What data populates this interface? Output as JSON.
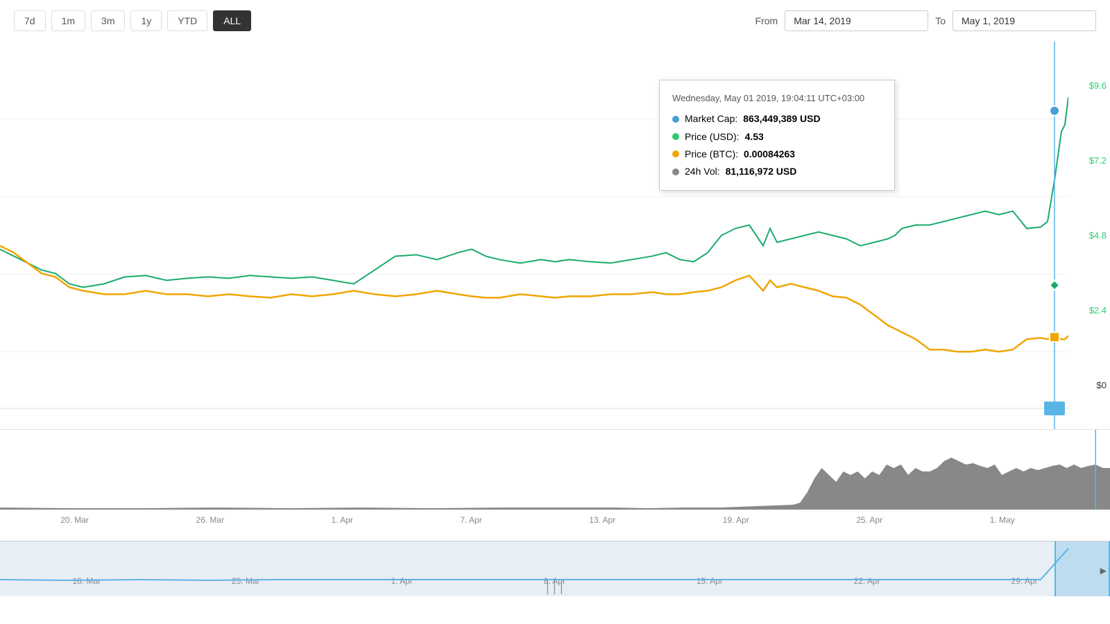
{
  "timeButtons": [
    {
      "label": "7d",
      "active": false
    },
    {
      "label": "1m",
      "active": false
    },
    {
      "label": "3m",
      "active": false
    },
    {
      "label": "1y",
      "active": false
    },
    {
      "label": "YTD",
      "active": false
    },
    {
      "label": "ALL",
      "active": true
    }
  ],
  "dateRange": {
    "fromLabel": "From",
    "fromValue": "Mar 14, 2019",
    "toLabel": "To",
    "toValue": "May 1, 2019"
  },
  "tooltip": {
    "title": "Wednesday, May 01 2019, 19:04:11 UTC+03:00",
    "marketCapLabel": "Market Cap:",
    "marketCapValue": "863,449,389 USD",
    "priceUSDLabel": "Price (USD):",
    "priceUSDValue": "4.53",
    "priceBTCLabel": "Price (BTC):",
    "priceBTCValue": "0.00084263",
    "volLabel": "24h Vol:",
    "volValue": "81,116,972 USD"
  },
  "yAxis": {
    "labels": [
      "$9.6",
      "$7.2",
      "$4.8",
      "$2.4",
      "$0"
    ]
  },
  "xAxis": {
    "labels": [
      "20. Mar",
      "26. Mar",
      "1. Apr",
      "7. Apr",
      "13. Apr",
      "19. Apr",
      "25. Apr",
      "1. May"
    ]
  },
  "navigator": {
    "labels": [
      "18. Mar",
      "25. Mar",
      "1. Apr",
      "8. Apr",
      "15. Apr",
      "22. Apr",
      "29. Apr"
    ]
  }
}
